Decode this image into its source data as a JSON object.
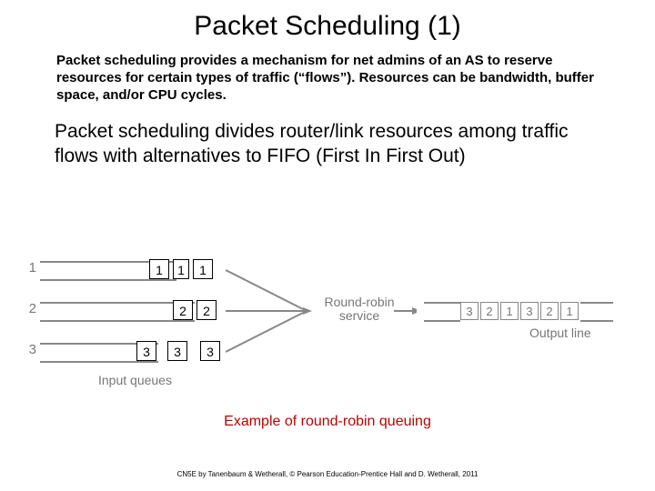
{
  "title": "Packet Scheduling (1)",
  "para1": "Packet scheduling provides a mechanism for net admins of an AS to reserve resources for certain types of traffic (“flows”). Resources can be bandwidth, buffer space, and/or CPU cycles.",
  "para2": "Packet scheduling divides router/link resources among traffic flows with alternatives to FIFO (First In First Out)",
  "queues": {
    "row1": {
      "num": "1",
      "cells": [
        "1",
        "1",
        "1"
      ]
    },
    "row2": {
      "num": "2",
      "cells": [
        "2",
        "2"
      ]
    },
    "row3": {
      "num": "3",
      "cells": [
        "3",
        "3",
        "3"
      ]
    }
  },
  "rr_label_l1": "Round-robin",
  "rr_label_l2": "service",
  "output_cells": [
    "3",
    "2",
    "1",
    "3",
    "2",
    "1"
  ],
  "input_queues_label": "Input queues",
  "output_line_label": "Output line",
  "caption": "Example of round-robin queuing",
  "footer": "CN5E by Tanenbaum & Wetherall, © Pearson Education-Prentice Hall and D. Wetherall, 2011"
}
